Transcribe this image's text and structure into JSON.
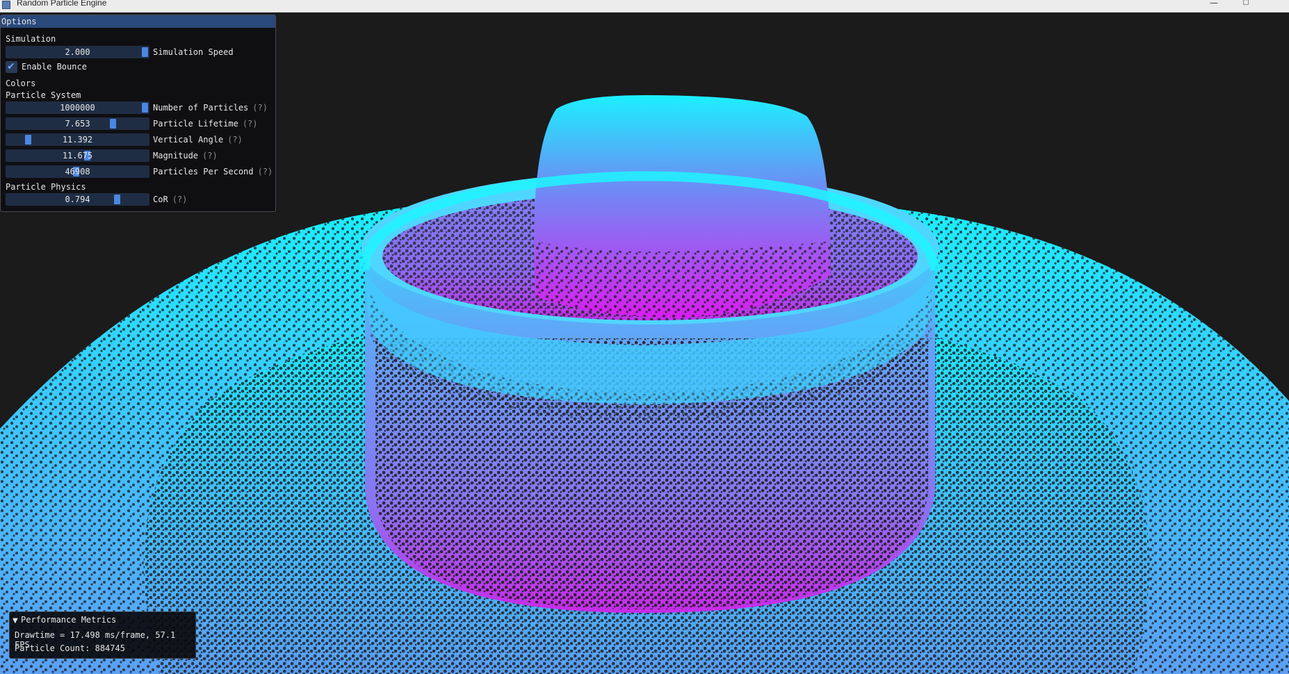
{
  "window": {
    "title": "Random Particle Engine",
    "minimize_label": "—",
    "maximize_label": "☐"
  },
  "options": {
    "title": "Options",
    "simulation": {
      "section": "Simulation",
      "speed": {
        "value": "2.000",
        "label": "Simulation Speed",
        "fraction": 1.0
      },
      "bounce": {
        "label": "Enable Bounce",
        "checked": true
      }
    },
    "colors_section": "Colors",
    "particle_system": {
      "section": "Particle System",
      "sliders": [
        {
          "value": "1000000",
          "label": "Number of Particles",
          "help": "(?)",
          "fraction": 1.0
        },
        {
          "value": "7.653",
          "label": "Particle Lifetime",
          "help": "(?)",
          "fraction": 0.66
        },
        {
          "value": "11.392",
          "label": "Vertical Angle",
          "help": "(?)",
          "fraction": 0.12
        },
        {
          "value": "11.675",
          "label": "Magnitude",
          "help": "(?)",
          "fraction": 0.49
        },
        {
          "value": "46908",
          "label": "Particles Per Second",
          "help": "(?)",
          "fraction": 0.42
        }
      ]
    },
    "particle_physics": {
      "section": "Particle Physics",
      "cor": {
        "value": "0.794",
        "label": "CoR",
        "help": "(?)",
        "fraction": 0.69
      }
    }
  },
  "performance": {
    "title": "Performance Metrics",
    "drawtime": "Drawtime = 17.498 ms/frame, 57.1 FPS",
    "particle_count": "Particle Count: 884745"
  },
  "colors": {
    "particle_cyan": "#18f2ff",
    "particle_blue": "#6e86f2",
    "particle_magenta": "#d81ef0",
    "background": "#1b1b1b",
    "imgui_header": "#29497b",
    "imgui_slider_grab": "#4a87e0"
  }
}
